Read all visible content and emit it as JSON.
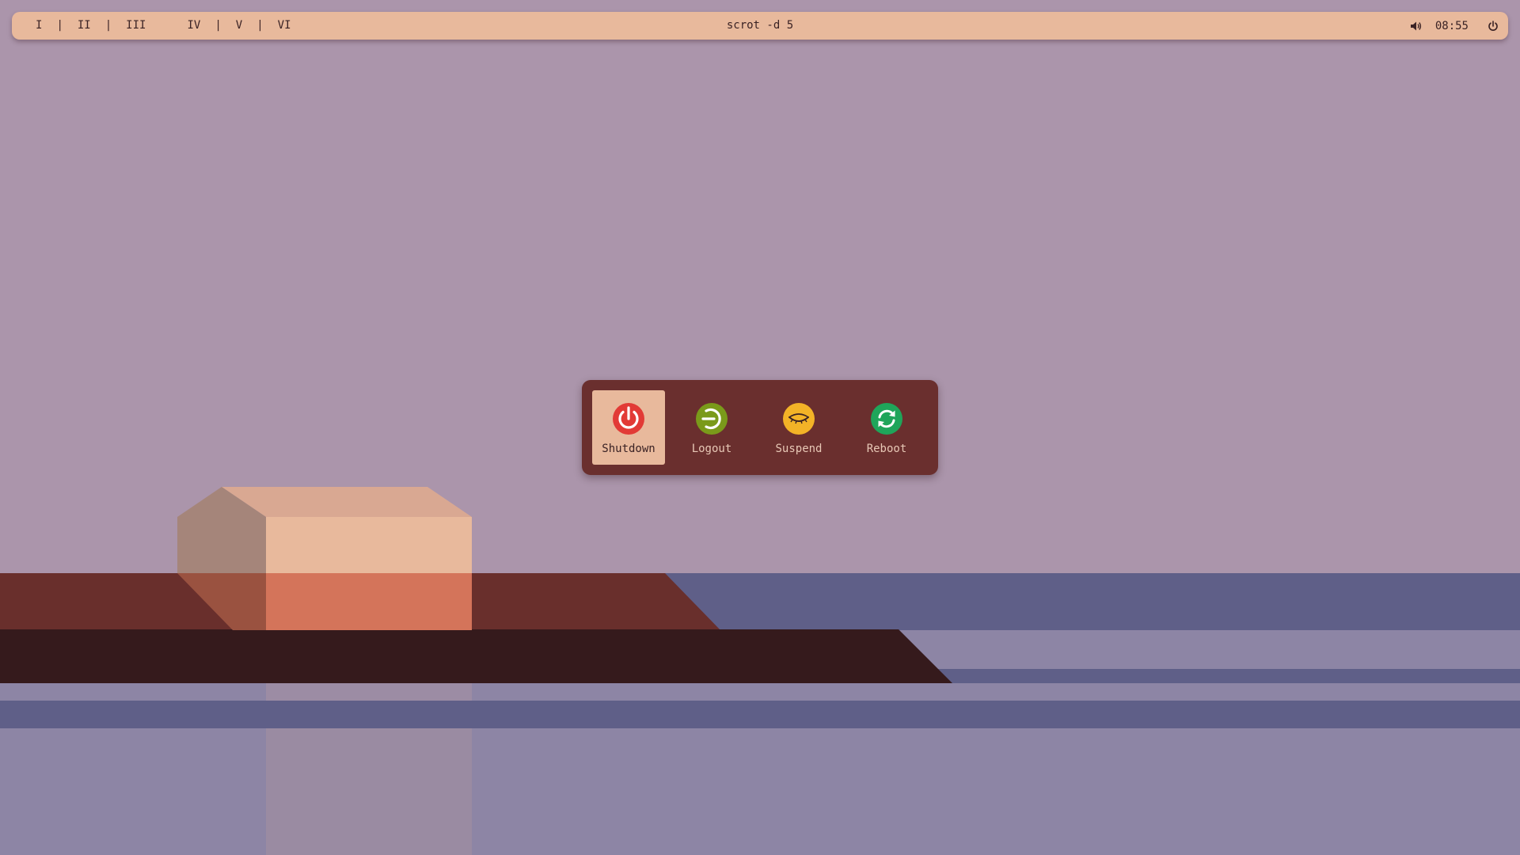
{
  "topbar": {
    "workspaces": [
      "I",
      "II",
      "III",
      "IV",
      "V",
      "VI"
    ],
    "separator": "|",
    "window_title": "scrot -d 5",
    "clock": "08:55"
  },
  "power_menu": {
    "selected": "shutdown",
    "items": [
      {
        "label": "Shutdown",
        "icon": "power-icon",
        "color": "#e23a36"
      },
      {
        "label": "Logout",
        "icon": "logout-icon",
        "color": "#7a9a1a"
      },
      {
        "label": "Suspend",
        "icon": "sleep-eye-icon",
        "color": "#f3b327"
      },
      {
        "label": "Reboot",
        "icon": "refresh-icon",
        "color": "#1fa55a"
      }
    ]
  },
  "colors": {
    "bar_bg": "#e8b99c",
    "menu_bg": "#6a2f2e",
    "sky": "#ab95ab"
  }
}
